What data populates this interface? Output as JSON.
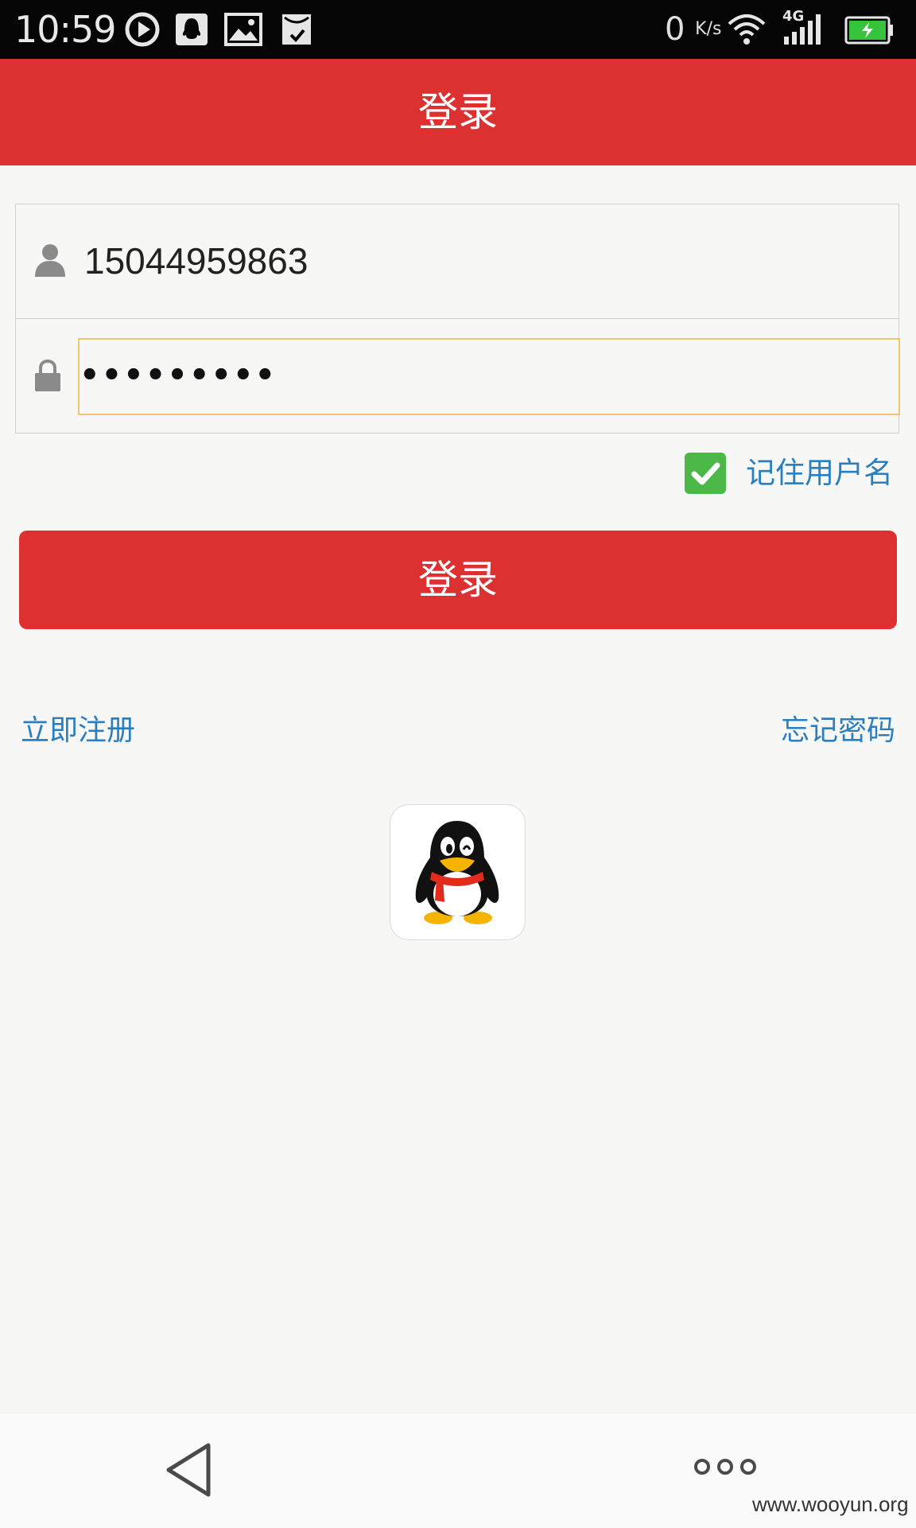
{
  "status_bar": {
    "time": "10:59",
    "net_speed": "0",
    "net_speed_unit": "K/s",
    "network_type": "4G",
    "icons": [
      "play-circle-icon",
      "qq-notify-icon",
      "image-icon",
      "shopping-bag-icon",
      "wifi-icon",
      "signal-icon",
      "battery-charging-icon"
    ]
  },
  "header": {
    "title": "登录"
  },
  "form": {
    "username": "15044959863",
    "password_mask": "•••••••••"
  },
  "remember": {
    "label": "记住用户名",
    "checked": true
  },
  "login_button": {
    "label": "登录"
  },
  "links": {
    "register": "立即注册",
    "forgot_password": "忘记密码"
  },
  "social_login": {
    "icon": "qq-penguin-icon"
  },
  "nav": {
    "back": "back-icon",
    "more": "more-icon"
  },
  "watermark": "www.wooyun.org",
  "colors": {
    "accent_red": "#dd3131",
    "link_blue": "#2a7fc0",
    "check_green": "#4cb847",
    "focus_border": "#f2c66c"
  }
}
